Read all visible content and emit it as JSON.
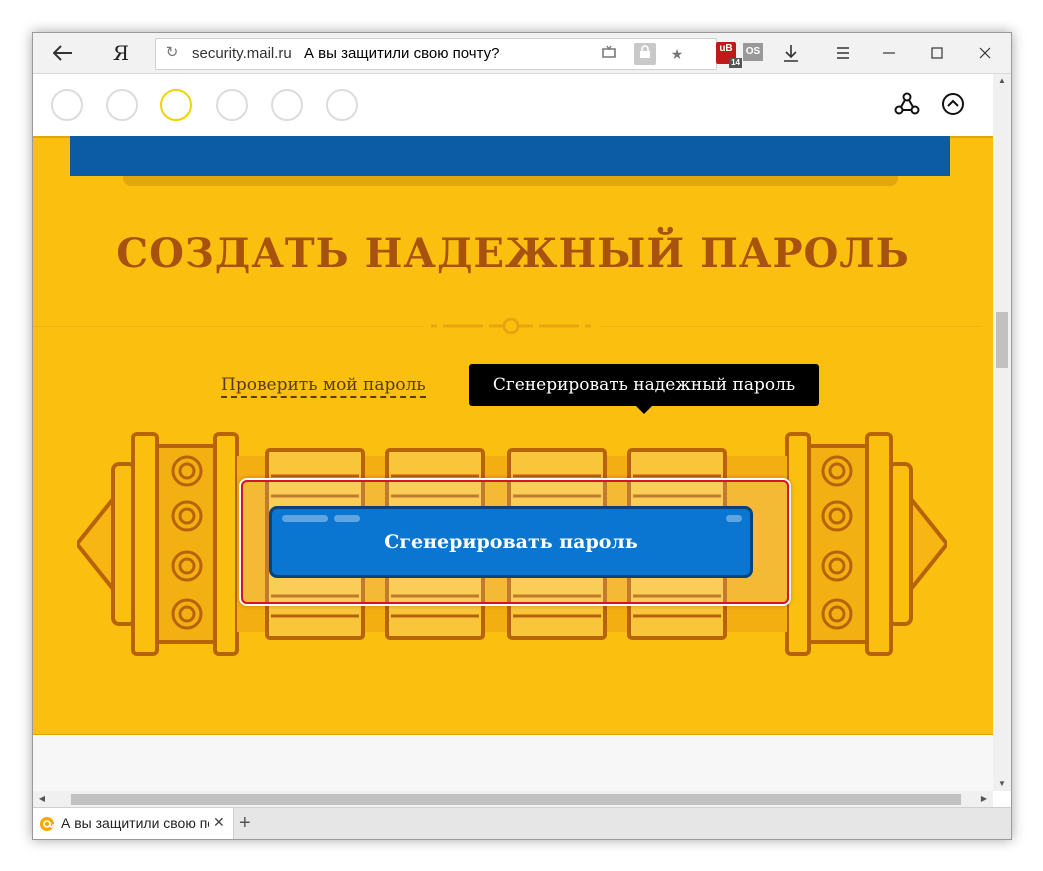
{
  "browser": {
    "logo": "Я",
    "address_domain": "security.mail.ru",
    "address_title": "А вы защитили свою почту?",
    "ext_counter": "14",
    "ext_os_label": "OS",
    "icons": [
      "back-arrow-icon",
      "yandex-logo",
      "reload-icon",
      "cast-icon",
      "lock-icon",
      "bookmark-star-icon",
      "extension-icon",
      "download-icon",
      "menu-icon",
      "minimize-icon",
      "maximize-icon",
      "close-icon"
    ]
  },
  "page": {
    "headline": "СОЗДАТЬ НАДЕЖНЫЙ ПАРОЛЬ",
    "check_link": "Проверить мой пароль",
    "tooltip": "Сгенерировать надежный пароль",
    "generate_button": "Сгенерировать пароль",
    "colors": {
      "section_bg": "#fbc00f",
      "headline": "#a8520f",
      "button_bg": "#0a76d2",
      "highlight": "#d6132b",
      "top_bar": "#0b5ba5"
    },
    "step_dots_count": 6,
    "active_step": 3
  },
  "tabs": [
    {
      "title": "А вы защитили свою поч",
      "favicon": "mail-at-icon"
    }
  ]
}
